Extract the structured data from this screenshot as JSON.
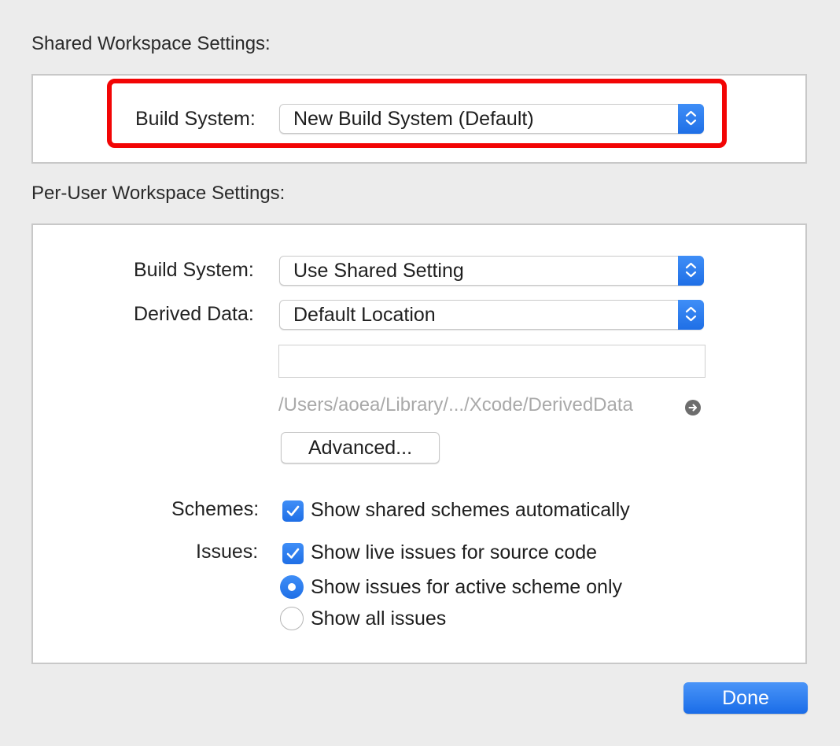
{
  "shared": {
    "title": "Shared Workspace Settings:",
    "build_system": {
      "label": "Build System:",
      "value": "New Build System (Default)",
      "highlighted": true
    }
  },
  "per_user": {
    "title": "Per-User Workspace Settings:",
    "build_system": {
      "label": "Build System:",
      "value": "Use Shared Setting"
    },
    "derived_data": {
      "label": "Derived Data:",
      "value": "Default Location",
      "custom_path_value": "",
      "path": "/Users/aoea/Library/.../Xcode/DerivedData"
    },
    "advanced_label": "Advanced...",
    "schemes": {
      "label": "Schemes:",
      "option": "Show shared schemes automatically",
      "checked": true
    },
    "issues": {
      "label": "Issues:",
      "live_option": "Show live issues for source code",
      "live_checked": true,
      "radio_options": [
        {
          "label": "Show issues for active scheme only",
          "selected": true
        },
        {
          "label": "Show all issues",
          "selected": false
        }
      ]
    }
  },
  "done_label": "Done",
  "colors": {
    "accent": "#1f6fe6",
    "highlight": "#f20505",
    "background": "#ececec"
  }
}
